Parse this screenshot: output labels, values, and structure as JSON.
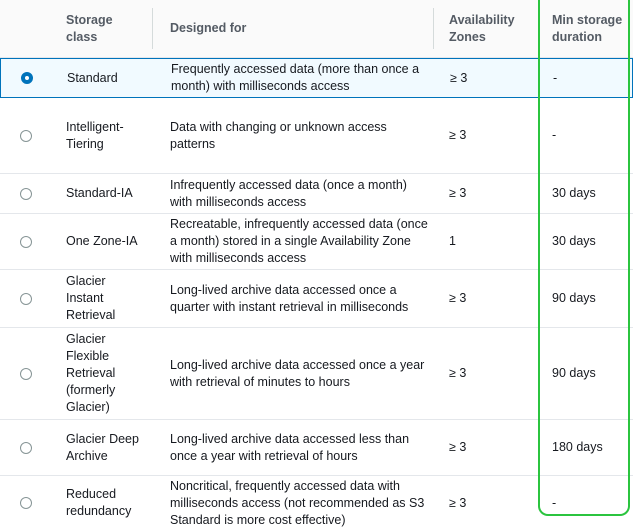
{
  "headers": {
    "storage_class": "Storage class",
    "designed_for": "Designed for",
    "availability_zones": "Availability Zones",
    "min_storage_duration": "Min storage duration"
  },
  "rows": [
    {
      "storage_class": "Standard",
      "designed_for": "Frequently accessed data (more than once a month) with milliseconds access",
      "availability_zones": "≥ 3",
      "min_storage_duration": "-",
      "selected": true
    },
    {
      "storage_class": "Intelligent-Tiering",
      "designed_for": "Data with changing or unknown access patterns",
      "availability_zones": "≥ 3",
      "min_storage_duration": "-",
      "selected": false
    },
    {
      "storage_class": "Standard-IA",
      "designed_for": "Infrequently accessed data (once a month) with milliseconds access",
      "availability_zones": "≥ 3",
      "min_storage_duration": "30 days",
      "selected": false
    },
    {
      "storage_class": "One Zone-IA",
      "designed_for": "Recreatable, infrequently accessed data (once a month) stored in a single Availability Zone with milliseconds access",
      "availability_zones": "1",
      "min_storage_duration": "30 days",
      "selected": false
    },
    {
      "storage_class": "Glacier Instant Retrieval",
      "designed_for": "Long-lived archive data accessed once a quarter with instant retrieval in milliseconds",
      "availability_zones": "≥ 3",
      "min_storage_duration": "90 days",
      "selected": false
    },
    {
      "storage_class": "Glacier Flexible Retrieval (formerly Glacier)",
      "designed_for": "Long-lived archive data accessed once a year with retrieval of minutes to hours",
      "availability_zones": "≥ 3",
      "min_storage_duration": "90 days",
      "selected": false
    },
    {
      "storage_class": "Glacier Deep Archive",
      "designed_for": "Long-lived archive data accessed less than once a year with retrieval of hours",
      "availability_zones": "≥ 3",
      "min_storage_duration": "180 days",
      "selected": false
    },
    {
      "storage_class": "Reduced redundancy",
      "designed_for": "Noncritical, frequently accessed data with milliseconds access (not recommended as S3 Standard is more cost effective)",
      "availability_zones": "≥ 3",
      "min_storage_duration": "-",
      "selected": false
    }
  ],
  "colors": {
    "accent": "#0073bb",
    "highlight_box": "#2bc43f"
  }
}
